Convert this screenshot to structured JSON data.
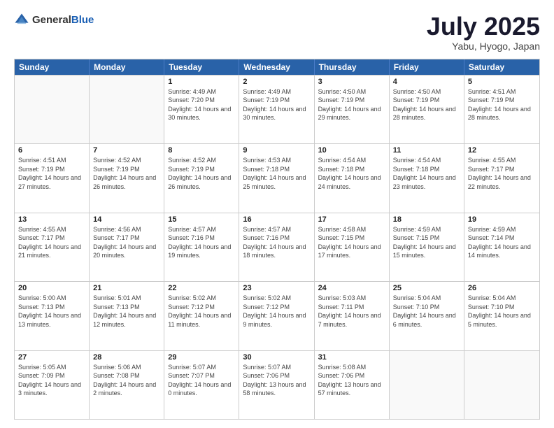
{
  "header": {
    "logo_general": "General",
    "logo_blue": "Blue",
    "month_title": "July 2025",
    "location": "Yabu, Hyogo, Japan"
  },
  "days_of_week": [
    "Sunday",
    "Monday",
    "Tuesday",
    "Wednesday",
    "Thursday",
    "Friday",
    "Saturday"
  ],
  "weeks": [
    [
      {
        "day": "",
        "sunrise": "",
        "sunset": "",
        "daylight": ""
      },
      {
        "day": "",
        "sunrise": "",
        "sunset": "",
        "daylight": ""
      },
      {
        "day": "1",
        "sunrise": "Sunrise: 4:49 AM",
        "sunset": "Sunset: 7:20 PM",
        "daylight": "Daylight: 14 hours and 30 minutes."
      },
      {
        "day": "2",
        "sunrise": "Sunrise: 4:49 AM",
        "sunset": "Sunset: 7:19 PM",
        "daylight": "Daylight: 14 hours and 30 minutes."
      },
      {
        "day": "3",
        "sunrise": "Sunrise: 4:50 AM",
        "sunset": "Sunset: 7:19 PM",
        "daylight": "Daylight: 14 hours and 29 minutes."
      },
      {
        "day": "4",
        "sunrise": "Sunrise: 4:50 AM",
        "sunset": "Sunset: 7:19 PM",
        "daylight": "Daylight: 14 hours and 28 minutes."
      },
      {
        "day": "5",
        "sunrise": "Sunrise: 4:51 AM",
        "sunset": "Sunset: 7:19 PM",
        "daylight": "Daylight: 14 hours and 28 minutes."
      }
    ],
    [
      {
        "day": "6",
        "sunrise": "Sunrise: 4:51 AM",
        "sunset": "Sunset: 7:19 PM",
        "daylight": "Daylight: 14 hours and 27 minutes."
      },
      {
        "day": "7",
        "sunrise": "Sunrise: 4:52 AM",
        "sunset": "Sunset: 7:19 PM",
        "daylight": "Daylight: 14 hours and 26 minutes."
      },
      {
        "day": "8",
        "sunrise": "Sunrise: 4:52 AM",
        "sunset": "Sunset: 7:19 PM",
        "daylight": "Daylight: 14 hours and 26 minutes."
      },
      {
        "day": "9",
        "sunrise": "Sunrise: 4:53 AM",
        "sunset": "Sunset: 7:18 PM",
        "daylight": "Daylight: 14 hours and 25 minutes."
      },
      {
        "day": "10",
        "sunrise": "Sunrise: 4:54 AM",
        "sunset": "Sunset: 7:18 PM",
        "daylight": "Daylight: 14 hours and 24 minutes."
      },
      {
        "day": "11",
        "sunrise": "Sunrise: 4:54 AM",
        "sunset": "Sunset: 7:18 PM",
        "daylight": "Daylight: 14 hours and 23 minutes."
      },
      {
        "day": "12",
        "sunrise": "Sunrise: 4:55 AM",
        "sunset": "Sunset: 7:17 PM",
        "daylight": "Daylight: 14 hours and 22 minutes."
      }
    ],
    [
      {
        "day": "13",
        "sunrise": "Sunrise: 4:55 AM",
        "sunset": "Sunset: 7:17 PM",
        "daylight": "Daylight: 14 hours and 21 minutes."
      },
      {
        "day": "14",
        "sunrise": "Sunrise: 4:56 AM",
        "sunset": "Sunset: 7:17 PM",
        "daylight": "Daylight: 14 hours and 20 minutes."
      },
      {
        "day": "15",
        "sunrise": "Sunrise: 4:57 AM",
        "sunset": "Sunset: 7:16 PM",
        "daylight": "Daylight: 14 hours and 19 minutes."
      },
      {
        "day": "16",
        "sunrise": "Sunrise: 4:57 AM",
        "sunset": "Sunset: 7:16 PM",
        "daylight": "Daylight: 14 hours and 18 minutes."
      },
      {
        "day": "17",
        "sunrise": "Sunrise: 4:58 AM",
        "sunset": "Sunset: 7:15 PM",
        "daylight": "Daylight: 14 hours and 17 minutes."
      },
      {
        "day": "18",
        "sunrise": "Sunrise: 4:59 AM",
        "sunset": "Sunset: 7:15 PM",
        "daylight": "Daylight: 14 hours and 15 minutes."
      },
      {
        "day": "19",
        "sunrise": "Sunrise: 4:59 AM",
        "sunset": "Sunset: 7:14 PM",
        "daylight": "Daylight: 14 hours and 14 minutes."
      }
    ],
    [
      {
        "day": "20",
        "sunrise": "Sunrise: 5:00 AM",
        "sunset": "Sunset: 7:13 PM",
        "daylight": "Daylight: 14 hours and 13 minutes."
      },
      {
        "day": "21",
        "sunrise": "Sunrise: 5:01 AM",
        "sunset": "Sunset: 7:13 PM",
        "daylight": "Daylight: 14 hours and 12 minutes."
      },
      {
        "day": "22",
        "sunrise": "Sunrise: 5:02 AM",
        "sunset": "Sunset: 7:12 PM",
        "daylight": "Daylight: 14 hours and 11 minutes."
      },
      {
        "day": "23",
        "sunrise": "Sunrise: 5:02 AM",
        "sunset": "Sunset: 7:12 PM",
        "daylight": "Daylight: 14 hours and 9 minutes."
      },
      {
        "day": "24",
        "sunrise": "Sunrise: 5:03 AM",
        "sunset": "Sunset: 7:11 PM",
        "daylight": "Daylight: 14 hours and 7 minutes."
      },
      {
        "day": "25",
        "sunrise": "Sunrise: 5:04 AM",
        "sunset": "Sunset: 7:10 PM",
        "daylight": "Daylight: 14 hours and 6 minutes."
      },
      {
        "day": "26",
        "sunrise": "Sunrise: 5:04 AM",
        "sunset": "Sunset: 7:10 PM",
        "daylight": "Daylight: 14 hours and 5 minutes."
      }
    ],
    [
      {
        "day": "27",
        "sunrise": "Sunrise: 5:05 AM",
        "sunset": "Sunset: 7:09 PM",
        "daylight": "Daylight: 14 hours and 3 minutes."
      },
      {
        "day": "28",
        "sunrise": "Sunrise: 5:06 AM",
        "sunset": "Sunset: 7:08 PM",
        "daylight": "Daylight: 14 hours and 2 minutes."
      },
      {
        "day": "29",
        "sunrise": "Sunrise: 5:07 AM",
        "sunset": "Sunset: 7:07 PM",
        "daylight": "Daylight: 14 hours and 0 minutes."
      },
      {
        "day": "30",
        "sunrise": "Sunrise: 5:07 AM",
        "sunset": "Sunset: 7:06 PM",
        "daylight": "Daylight: 13 hours and 58 minutes."
      },
      {
        "day": "31",
        "sunrise": "Sunrise: 5:08 AM",
        "sunset": "Sunset: 7:06 PM",
        "daylight": "Daylight: 13 hours and 57 minutes."
      },
      {
        "day": "",
        "sunrise": "",
        "sunset": "",
        "daylight": ""
      },
      {
        "day": "",
        "sunrise": "",
        "sunset": "",
        "daylight": ""
      }
    ]
  ]
}
